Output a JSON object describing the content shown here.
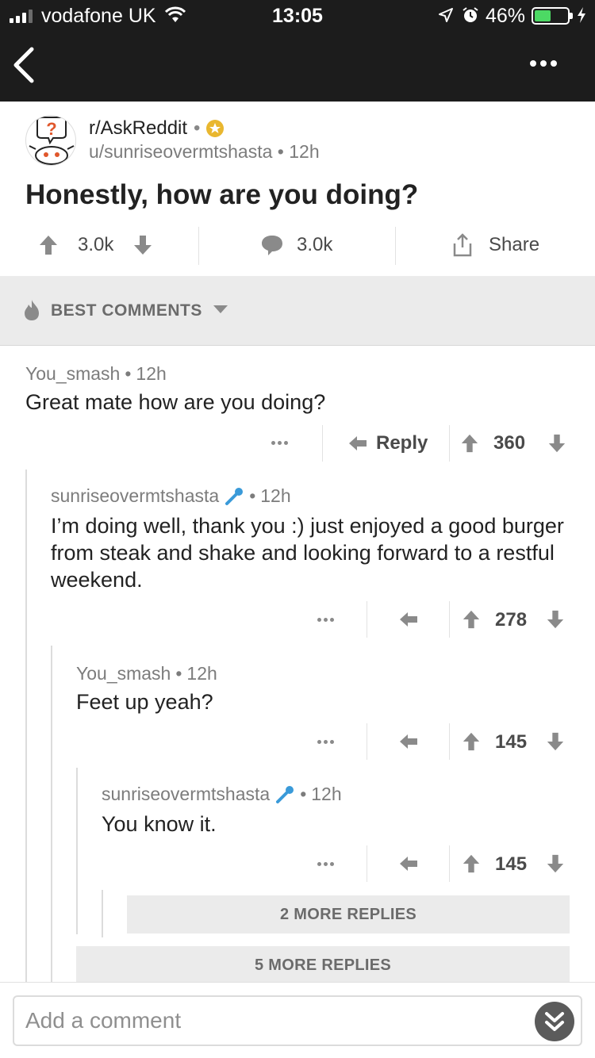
{
  "status_bar": {
    "carrier": "vodafone UK",
    "time": "13:05",
    "battery_percent": "46%",
    "battery_level": 0.46
  },
  "nav": {
    "back_icon": "chevron-left-icon",
    "more_icon": "more-horizontal-icon"
  },
  "post": {
    "subreddit": "r/AskReddit",
    "author": "u/sunriseovermtshasta",
    "age": "12h",
    "title": "Honestly, how are you doing?",
    "score": "3.0k",
    "comment_count": "3.0k",
    "share_label": "Share"
  },
  "sort": {
    "label": "BEST COMMENTS"
  },
  "comments": [
    {
      "author": "You_smash",
      "age": "12h",
      "body": "Great mate how are you doing?",
      "score": "360",
      "reply_label": "Reply"
    },
    {
      "author": "sunriseovermtshasta",
      "age": "12h",
      "body": "I’m doing well, thank you :) just enjoyed a good burger from steak and shake and looking forward to a restful weekend.",
      "score": "278"
    },
    {
      "author": "You_smash",
      "age": "12h",
      "body": "Feet up yeah?",
      "score": "145"
    },
    {
      "author": "sunriseovermtshasta",
      "age": "12h",
      "body": "You know it.",
      "score": "145"
    }
  ],
  "more_replies": [
    {
      "label": "2 MORE REPLIES"
    },
    {
      "label": "5 MORE REPLIES"
    }
  ],
  "composer": {
    "placeholder": "Add a comment"
  },
  "colors": {
    "topbar": "#1c1c1c",
    "battery": "#4cd964",
    "gold": "#e9b72f",
    "op_badge": "#3a9ad9"
  }
}
